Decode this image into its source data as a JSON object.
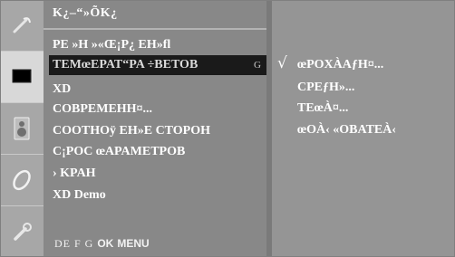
{
  "menu": {
    "title": "K¿–“»ÕK¿",
    "items": [
      {
        "label": "PE  »H »«Œ¡P¿  EH»fl",
        "selected": false
      },
      {
        "label": "TEMœEPAT“PA ÷BETOB",
        "selected": true,
        "hint": "G"
      },
      {
        "label": "XD",
        "selected": false
      },
      {
        "label": "COBPEMEHH¤...",
        "selected": false
      },
      {
        "label": "COOTHOÿ EH»E CTOPOH",
        "selected": false
      },
      {
        "label": "C¡POC œAPAMETPOB",
        "selected": false
      },
      {
        "label": "› KPAH",
        "selected": false
      },
      {
        "label": "XD Demo",
        "selected": false
      }
    ]
  },
  "submenu": {
    "check_mark": "√",
    "items": [
      {
        "label": "œPOXÀAƒH¤...",
        "checked": true
      },
      {
        "label": "CPEƒH»...",
        "checked": false
      },
      {
        "label": "TEœÀ¤...",
        "checked": false
      },
      {
        "label": "œOÀ‹ «OBATEÀ‹",
        "checked": false
      }
    ]
  },
  "footer": {
    "keys": "DE  F  G",
    "ok": "OK",
    "menu": "MENU"
  },
  "sidebar_icons": [
    "satellite-dish-icon",
    "picture-icon",
    "speaker-icon",
    "disc-icon",
    "wrench-icon"
  ]
}
